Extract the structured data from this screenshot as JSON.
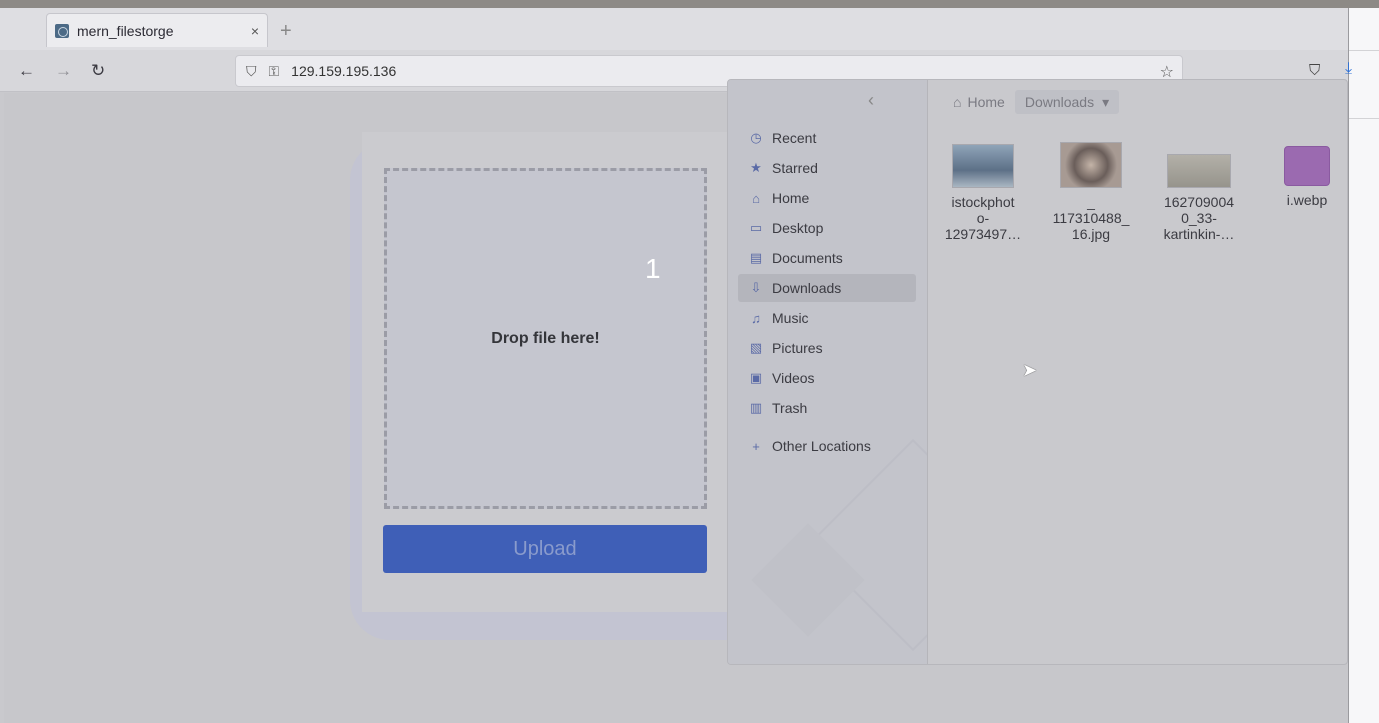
{
  "browser": {
    "tab_title": "mern_filestorge",
    "tab_close": "×",
    "new_tab": "+",
    "url": "129.159.195.136",
    "back": "←",
    "forward": "→",
    "reload": "↻",
    "star": "☆"
  },
  "page": {
    "drop_text": "Drop file here!",
    "upload_label": "Upload",
    "counter": "1"
  },
  "dialog": {
    "back_arrow": "‹",
    "path": {
      "home": "Home",
      "current": "Downloads",
      "current_arrow": "▾"
    },
    "sidebar": [
      {
        "label": "Recent",
        "icon": "clock-icon",
        "glyph": "◷"
      },
      {
        "label": "Starred",
        "icon": "star-icon",
        "glyph": "★"
      },
      {
        "label": "Home",
        "icon": "home-icon",
        "glyph": "⌂"
      },
      {
        "label": "Desktop",
        "icon": "desktop-icon",
        "glyph": "▭"
      },
      {
        "label": "Documents",
        "icon": "document-icon",
        "glyph": "▤"
      },
      {
        "label": "Downloads",
        "icon": "download-icon",
        "glyph": "⇩"
      },
      {
        "label": "Music",
        "icon": "music-icon",
        "glyph": "♫"
      },
      {
        "label": "Pictures",
        "icon": "picture-icon",
        "glyph": "▧"
      },
      {
        "label": "Videos",
        "icon": "video-icon",
        "glyph": "▣"
      },
      {
        "label": "Trash",
        "icon": "trash-icon",
        "glyph": "▥"
      }
    ],
    "other_locations": {
      "label": "Other Locations",
      "glyph": "+"
    },
    "files": [
      {
        "name_line1": "istockphot",
        "name_line2": "o-",
        "name_line3": "12973497…"
      },
      {
        "name_line1": "_",
        "name_line2": "117310488_",
        "name_line3": "16.jpg"
      },
      {
        "name_line1": "162709004",
        "name_line2": "0_33-",
        "name_line3": "kartinkin-…"
      },
      {
        "name_line1": "i.webp",
        "name_line2": "",
        "name_line3": ""
      }
    ]
  }
}
